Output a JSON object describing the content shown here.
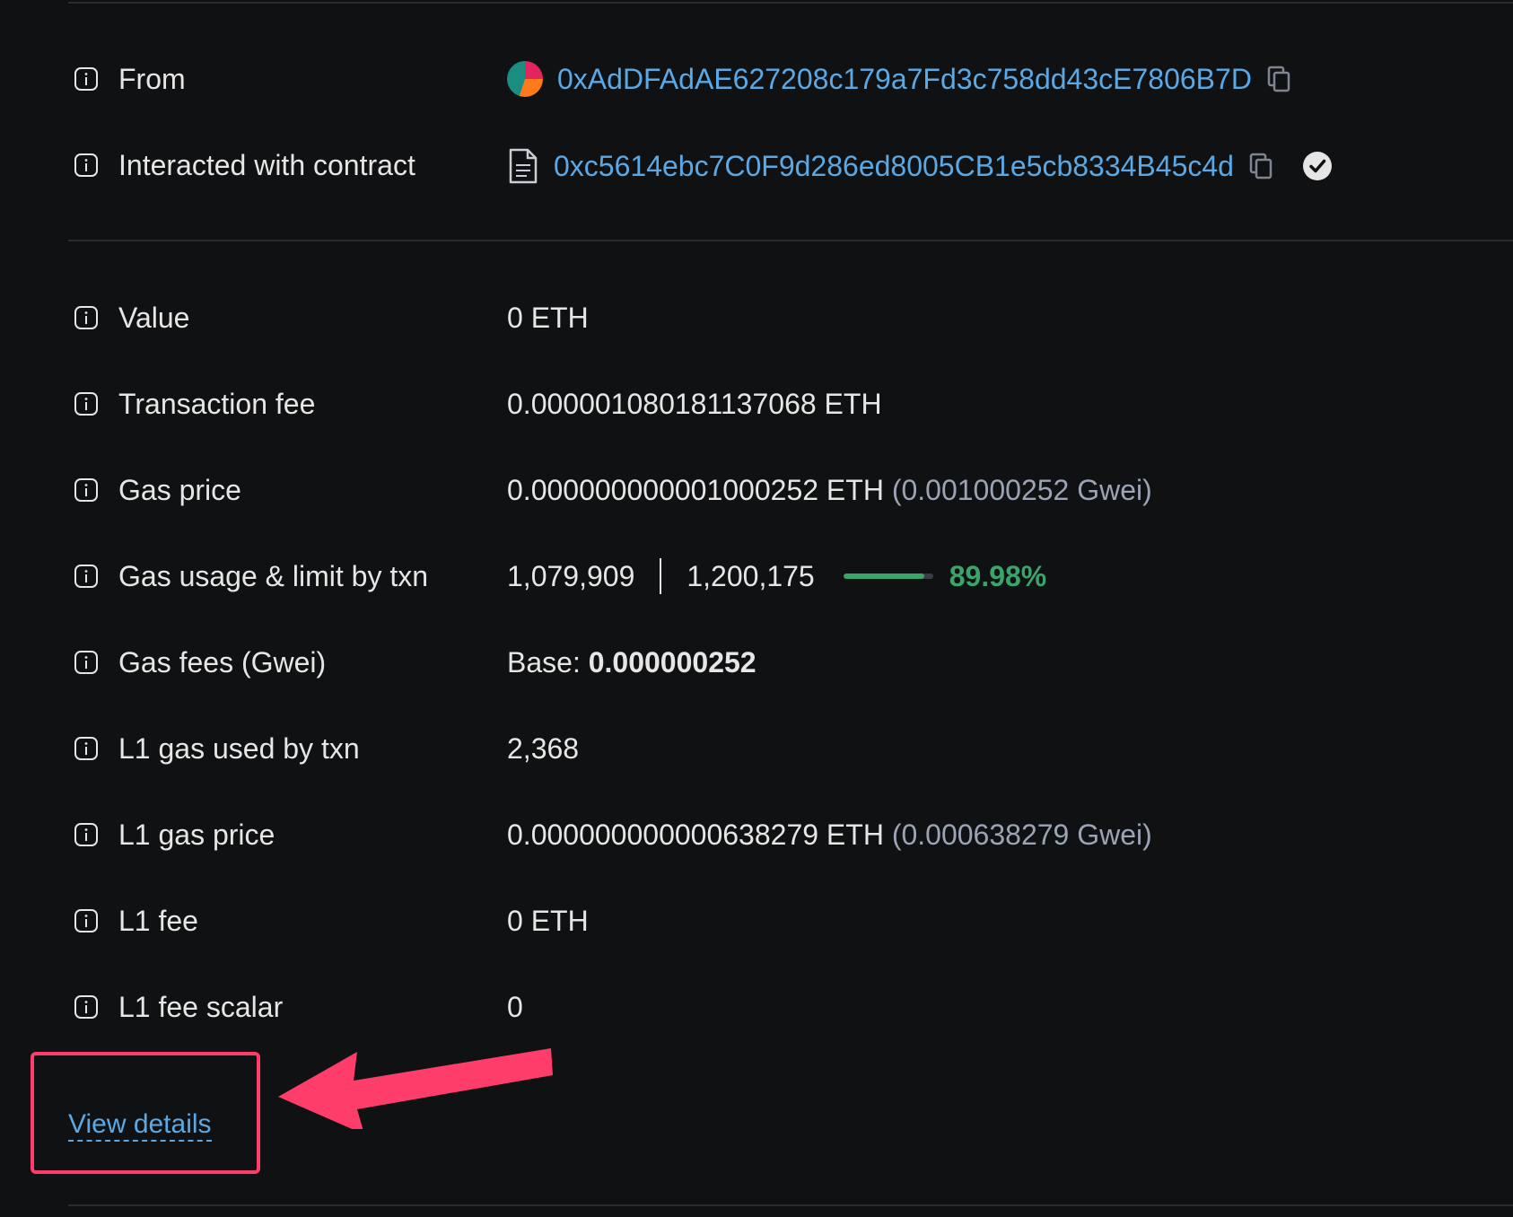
{
  "colors": {
    "background": "#101112",
    "link": "#5aa9e6",
    "success": "#3aa56b",
    "annotation": "#ff3d6a"
  },
  "rows": {
    "from": {
      "label": "From",
      "address": "0xAdDFAdAE627208c179a7Fd3c758dd43cE7806B7D"
    },
    "contract": {
      "label": "Interacted with contract",
      "address": "0xc5614ebc7C0F9d286ed8005CB1e5cb8334B45c4d"
    },
    "value": {
      "label": "Value",
      "value": "0 ETH"
    },
    "tx_fee": {
      "label": "Transaction fee",
      "value": "0.000001080181137068 ETH"
    },
    "gas_price": {
      "label": "Gas price",
      "value": "0.000000000001000252 ETH",
      "secondary": "(0.001000252 Gwei)"
    },
    "gas_usage": {
      "label": "Gas usage & limit by txn",
      "used": "1,079,909",
      "limit": "1,200,175",
      "percent_text": "89.98%",
      "percent": 89.98
    },
    "gas_fees": {
      "label": "Gas fees (Gwei)",
      "prefix": "Base:",
      "value": "0.000000252"
    },
    "l1_gas_used": {
      "label": "L1 gas used by txn",
      "value": "2,368"
    },
    "l1_gas_price": {
      "label": "L1 gas price",
      "value": "0.000000000000638279 ETH",
      "secondary": "(0.000638279 Gwei)"
    },
    "l1_fee": {
      "label": "L1 fee",
      "value": "0 ETH"
    },
    "l1_fee_scalar": {
      "label": "L1 fee scalar",
      "value": "0"
    }
  },
  "view_details": {
    "label": "View details"
  }
}
